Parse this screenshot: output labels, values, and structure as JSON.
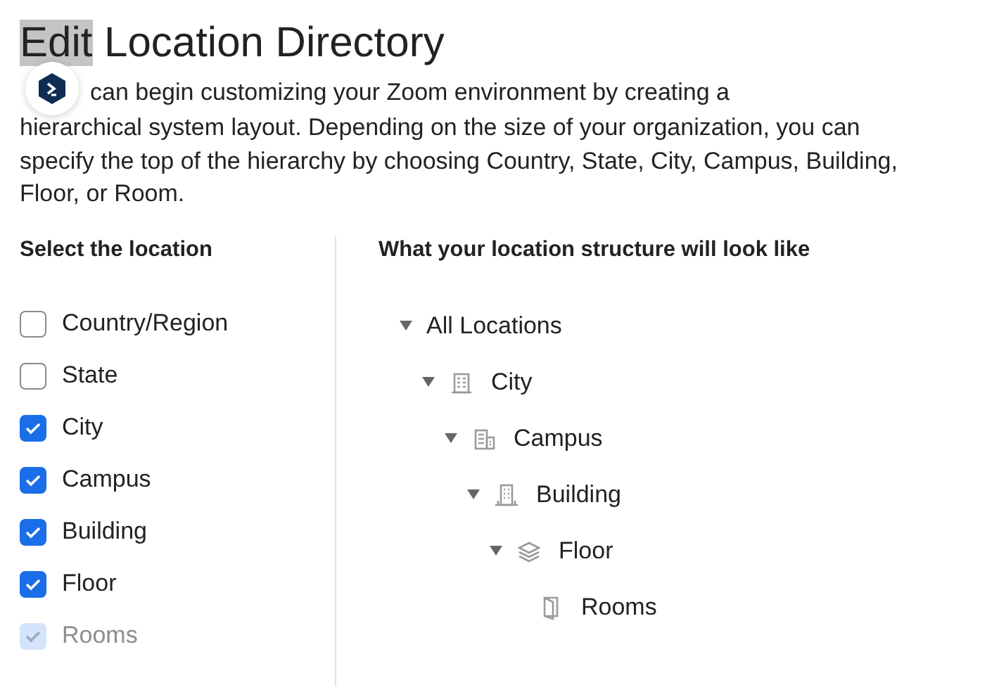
{
  "title": [
    {
      "text": "Edit",
      "highlighted": true
    },
    {
      "text": "Location Directory",
      "highlighted": false
    }
  ],
  "intro": [
    "can begin customizing your Zoom environment by creating a",
    "hierarchical system layout. Depending on the size of your organization, you can specify the top of the hierarchy by choosing Country, State, City, Campus, Building, Floor, or Room."
  ],
  "select_panel": {
    "heading": "Select the location",
    "options": [
      {
        "label": "Country/Region",
        "checked": false,
        "disabled": false
      },
      {
        "label": "State",
        "checked": false,
        "disabled": false
      },
      {
        "label": "City",
        "checked": true,
        "disabled": false
      },
      {
        "label": "Campus",
        "checked": true,
        "disabled": false
      },
      {
        "label": "Building",
        "checked": true,
        "disabled": false
      },
      {
        "label": "Floor",
        "checked": true,
        "disabled": false
      },
      {
        "label": "Rooms",
        "checked": true,
        "disabled": true
      }
    ]
  },
  "preview_panel": {
    "heading": "What your location structure will look like",
    "tree": [
      {
        "label": "All Locations",
        "expanded": true,
        "children": [
          {
            "label": "City",
            "kind": "city",
            "expanded": true,
            "children": [
              {
                "label": "Campus",
                "kind": "campus",
                "expanded": true,
                "children": [
                  {
                    "label": "Building",
                    "kind": "building",
                    "expanded": true,
                    "children": [
                      {
                        "label": "Floor",
                        "kind": "floor",
                        "expanded": true,
                        "children": [
                          {
                            "label": "Rooms",
                            "kind": "room"
                          }
                        ]
                      }
                    ]
                  }
                ]
              }
            ]
          }
        ]
      }
    ]
  }
}
